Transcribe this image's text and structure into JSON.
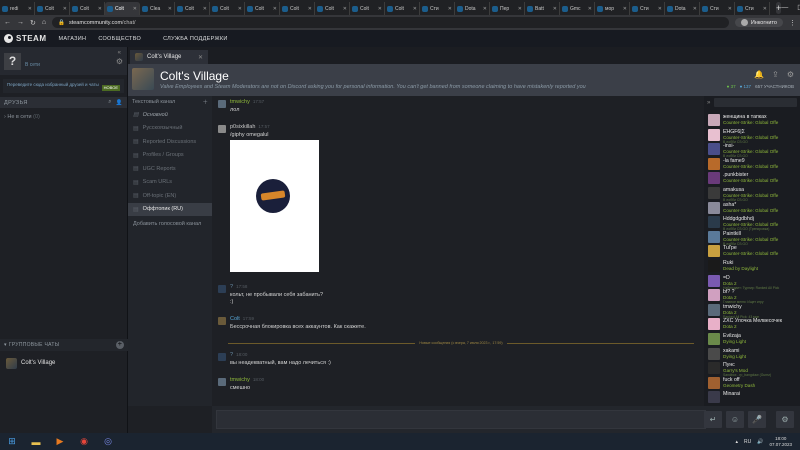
{
  "browser": {
    "tabs": [
      "redi",
      "Colt",
      "Colt",
      "Colt",
      "Clea",
      "Colt",
      "Colt",
      "Colt",
      "Colt",
      "Colt",
      "Colt",
      "Colt",
      "Сти",
      "Dota",
      "Пер",
      "Batt",
      "Gmc",
      "мор",
      "Сти",
      "Dota",
      "Сти",
      "Сти"
    ],
    "active_tab_index": 3,
    "url_domain": "steamcommunity.com",
    "url_path": "/chat/",
    "profile_label": "Инкогнито"
  },
  "steam": {
    "logo": "STEAM",
    "nav": [
      "МАГАЗИН",
      "СООБЩЕСТВО",
      "СЛУЖБА ПОДДЕРЖКИ"
    ]
  },
  "friends": {
    "status": "В сети",
    "promo_text": "Переведите сюда избранный друзей и чаты",
    "promo_badge": "НОВОЕ",
    "header": "ДРУЗЬЯ",
    "offline_label": "Не в сети",
    "offline_count": "(0)",
    "groups_header": "ГРУППОВЫЕ ЧАТЫ",
    "group_items": [
      "Colt's Village"
    ]
  },
  "chat_tab": {
    "label": "Colt's Village"
  },
  "group": {
    "title": "Colt's Village",
    "motd": "Valve Employees and Steam Moderators are not on Discord asking you for personal information. You can't get banned from someone claiming to have mistakenly reported you",
    "online_count": "37",
    "in_game_count": "137",
    "members_count": "657 УЧАСТНИКОВ"
  },
  "channels": {
    "header": "Текстовый канал",
    "items": [
      {
        "label": "Основной",
        "kind": "main"
      },
      {
        "label": "Русскоязычный",
        "kind": "normal"
      },
      {
        "label": "Reported Discussions",
        "kind": "normal"
      },
      {
        "label": "Profiles / Groups",
        "kind": "normal"
      },
      {
        "label": "UGC Reports",
        "kind": "normal"
      },
      {
        "label": "Scam URLs",
        "kind": "normal"
      },
      {
        "label": "Off-topic (EN)",
        "kind": "normal"
      },
      {
        "label": "Оффтопик (RU)",
        "kind": "active"
      }
    ],
    "add_voice": "Добавить голосовой канал"
  },
  "messages": [
    {
      "author": "tmwichy",
      "time": "17:57",
      "text": "лол",
      "name_color": "#8fb93b",
      "avatar": "#5a6a7a"
    },
    {
      "author": "p0sixkillah",
      "time": "17:57",
      "text": "/giphy omegalul",
      "name_color": "#c9c9c9",
      "avatar": "#8a8a8a"
    },
    {
      "author": "?",
      "time": "17:58",
      "text": "кольт, не пробывали себя забанить?",
      "text2": ":)",
      "name_color": "#6a8ea8",
      "avatar": "#2c3e55"
    },
    {
      "author": "Colt",
      "time": "17:59",
      "text": "Бессрочная блокировка всех аккаунтов. Как скажете.",
      "name_color": "#58a8d8",
      "avatar": "#6a5a3a"
    },
    {
      "author": "?",
      "time": "18:00",
      "text": "вы неадекватный, вам надо лечиться :)",
      "name_color": "#6a8ea8",
      "avatar": "#2c3e55"
    },
    {
      "author": "tmwichy",
      "time": "18:00",
      "text": "смешно",
      "name_color": "#8fb93b",
      "avatar": "#5a6a7a"
    }
  ],
  "new_messages_divider": "Новые сообщения (с вчера, 7 июля 2023 г., 17:59)",
  "members": [
    {
      "name": "женщина в тапках",
      "game": "Counter-Strike: Global Offe",
      "sub": "",
      "avatar": "#c8a8b8"
    },
    {
      "name": "Ε̄HGF6|Σ",
      "game": "Counter-Strike: Global Offe",
      "sub": "В лобби CS:GO",
      "avatar": "#e8c0d0"
    },
    {
      "name": "-insi-",
      "game": "Counter-Strike: Global Offe",
      "sub": "В лобби CS:GO",
      "avatar": "#4a4e8a"
    },
    {
      "name": "-la fame9",
      "game": "Counter-Strike: Global Offe",
      "sub": "",
      "avatar": "#b86a2a"
    },
    {
      "name": ".punkbister",
      "game": "Counter-Strike: Global Offe",
      "sub": "",
      "avatar": "#6a3a7a"
    },
    {
      "name": "amakusa",
      "game": "Counter-Strike: Global Offe",
      "sub": "В лобби CS:GO",
      "avatar": "#3a3a3a"
    },
    {
      "name": "asha*",
      "game": "Counter-Strike: Global Offe",
      "sub": "",
      "avatar": "#8a8a9a"
    },
    {
      "name": "Hddgdgdbhdj",
      "game": "Counter-Strike: Global Offe",
      "sub": "В лобби CS:GO (Тренировка)",
      "avatar": "#2a3a4a"
    },
    {
      "name": "Paintkill",
      "game": "Counter-Strike: Global Offe",
      "sub": "В лобби CS:GO",
      "avatar": "#5a7a9a"
    },
    {
      "name": "Tul'pe",
      "game": "Counter-Strike: Global Offe",
      "sub": "",
      "avatar": "#c8a040"
    },
    {
      "name": "Ruki",
      "game": "Dead by Daylight",
      "sub": "",
      "avatar": "#1a1a1a"
    },
    {
      "name": "=D",
      "game": "Dota 2",
      "sub": "Наблюдает: Турнир: Ranked All Pick",
      "avatar": "#7a5ab0"
    },
    {
      "name": "bf? ?",
      "game": "Dota 2",
      "sub": "Главное меню: Ищет игру",
      "avatar": "#d0a0c0"
    },
    {
      "name": "tmwichy",
      "game": "Dota 2",
      "sub": "Ranked All Pick: 43 мин",
      "avatar": "#5a6a7a"
    },
    {
      "name": "ZXC Улочка Мелвесочек",
      "game": "Dota 2",
      "sub": "",
      "avatar": "#e8b0c8"
    },
    {
      "name": "Evilzaja",
      "game": "Dying Light",
      "sub": "",
      "avatar": "#6a8a4a"
    },
    {
      "name": "xakami",
      "game": "Dying Light",
      "sub": "",
      "avatar": "#4a4a4a"
    },
    {
      "name": "Пунс",
      "game": "Garry's Mod",
      "sub": "Sandbox - rp_bangclaw (Gunsr)",
      "avatar": "#2a2a2a"
    },
    {
      "name": "fuck off",
      "game": "Geometry Dash",
      "sub": "",
      "avatar": "#a06030"
    },
    {
      "name": "Minarai",
      "game": "",
      "sub": "",
      "avatar": "#3a3a4a"
    }
  ],
  "taskbar": {
    "lang": "RU",
    "time": "18:00",
    "date": "07.07.2023"
  }
}
